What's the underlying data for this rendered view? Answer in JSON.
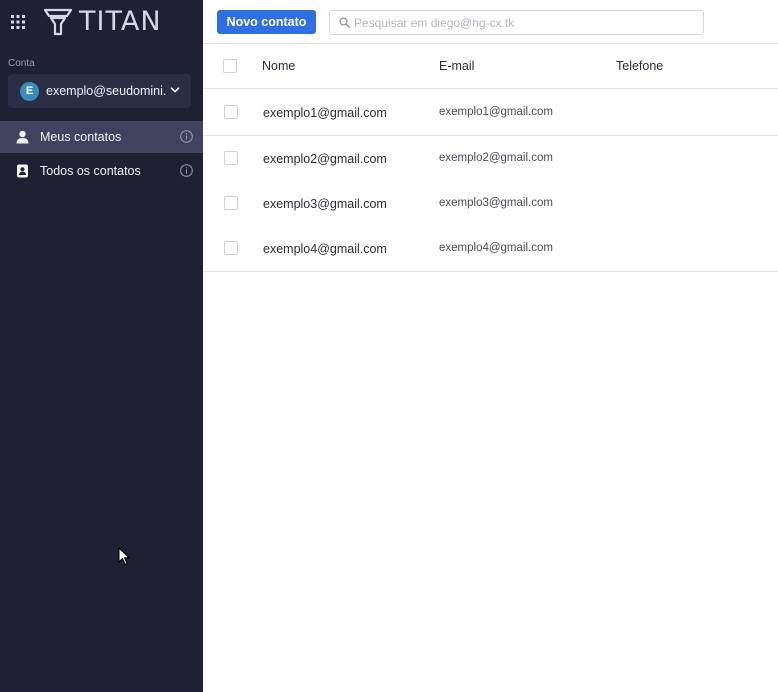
{
  "app": {
    "logo_text": "TITAN"
  },
  "sidebar": {
    "account_label": "Conta",
    "account": {
      "avatar_letter": "E",
      "email": "exemplo@seudomini..."
    },
    "items": [
      {
        "label": "Meus contatos",
        "active": true
      },
      {
        "label": "Todos os contatos",
        "active": false
      }
    ]
  },
  "toolbar": {
    "new_contact_label": "Novo contato",
    "search_placeholder": "Pesquisar em diego@hg-cx.tk"
  },
  "table": {
    "columns": [
      "Nome",
      "E-mail",
      "Telefone"
    ],
    "rows": [
      {
        "name": "exemplo1@gmail.com",
        "email": "exemplo1@gmail.com",
        "phone": ""
      },
      {
        "name": "exemplo2@gmail.com",
        "email": "exemplo2@gmail.com",
        "phone": ""
      },
      {
        "name": "exemplo3@gmail.com",
        "email": "exemplo3@gmail.com",
        "phone": ""
      },
      {
        "name": "exemplo4@gmail.com",
        "email": "exemplo4@gmail.com",
        "phone": ""
      }
    ]
  },
  "colors": {
    "sidebar_bg": "#1e2132",
    "active_item": "#40435e",
    "accent": "#2f6fe4",
    "avatar": "#3a8cbc"
  }
}
